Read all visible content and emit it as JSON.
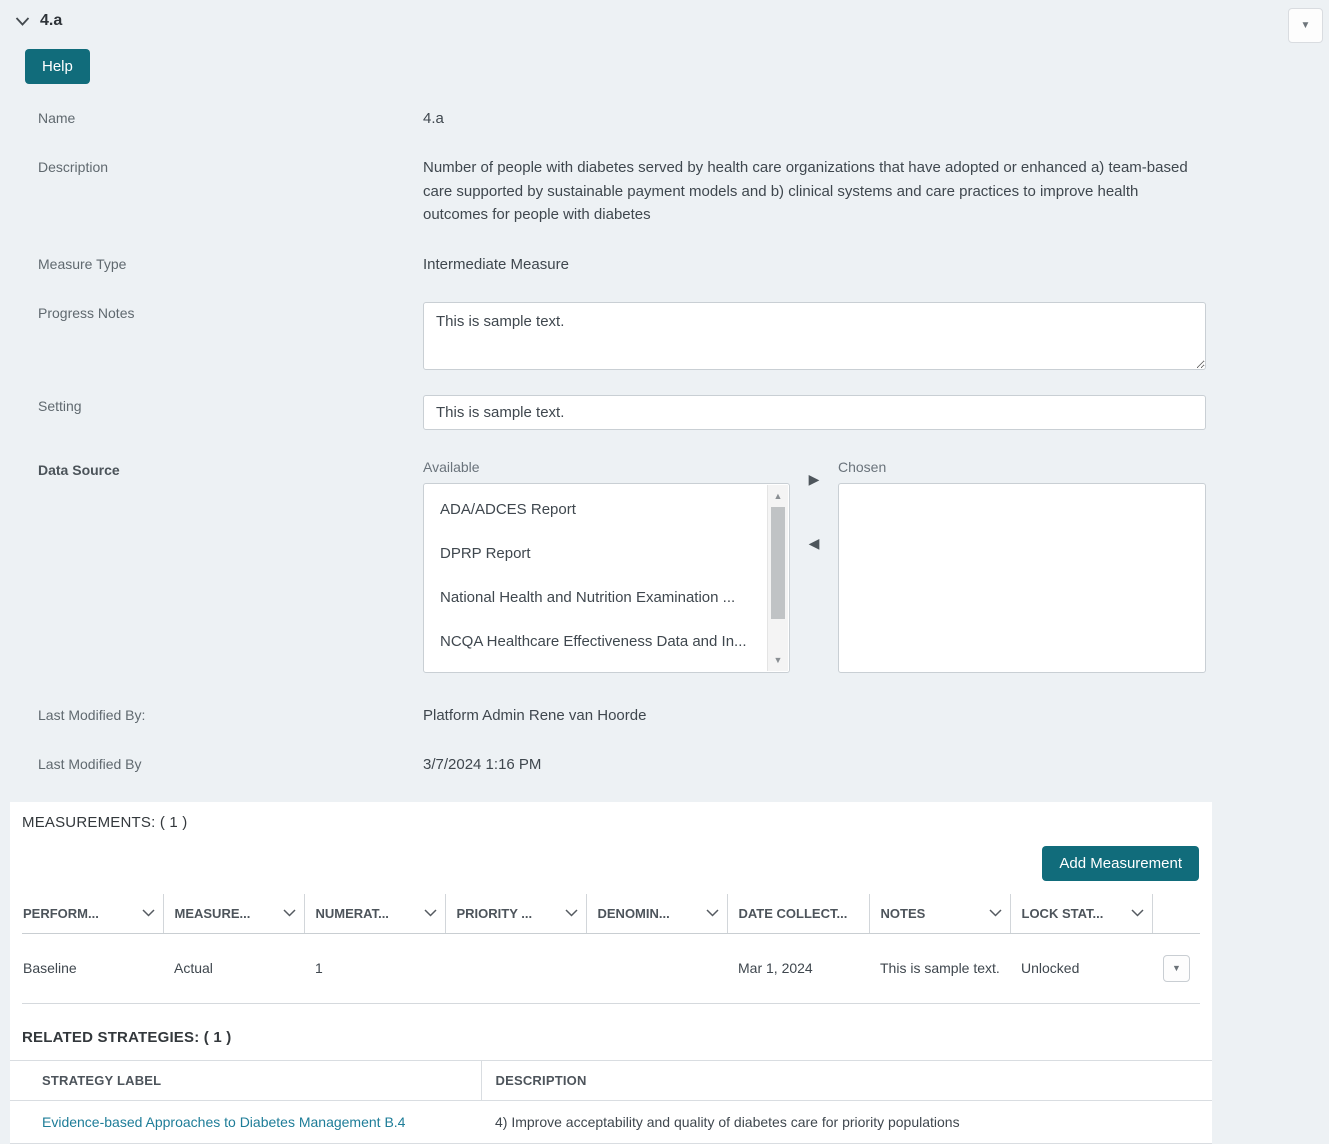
{
  "header": {
    "title": "4.a",
    "help_button": "Help"
  },
  "form": {
    "name": {
      "label": "Name",
      "value": "4.a"
    },
    "description": {
      "label": "Description",
      "value": "Number of people with diabetes served by health care organizations that have adopted or enhanced a) team-based care supported by sustainable payment models and b) clinical systems and care practices to improve health outcomes for people with diabetes"
    },
    "measure_type": {
      "label": "Measure Type",
      "value": "Intermediate Measure"
    },
    "progress_notes": {
      "label": "Progress Notes",
      "value": "This is sample text."
    },
    "setting": {
      "label": "Setting",
      "value": "This is sample text."
    },
    "data_source": {
      "label": "Data Source",
      "available_label": "Available",
      "chosen_label": "Chosen",
      "available_items": [
        "ADA/ADCES Report",
        "DPRP Report",
        "National Health and Nutrition Examination ...",
        "NCQA Healthcare Effectiveness Data and In..."
      ],
      "chosen_items": []
    },
    "last_modified_by": {
      "label": "Last Modified By:",
      "value": "Platform Admin Rene van Hoorde"
    },
    "last_modified_date": {
      "label": "Last Modified By",
      "value": "3/7/2024 1:16 PM"
    }
  },
  "measurements": {
    "title": "MEASUREMENTS: ( 1 )",
    "add_button": "Add Measurement",
    "columns": [
      {
        "label": "PERFORM...",
        "filter": true
      },
      {
        "label": "MEASURE...",
        "filter": true
      },
      {
        "label": "NUMERAT...",
        "filter": true
      },
      {
        "label": "PRIORITY ...",
        "filter": true
      },
      {
        "label": "DENOMIN...",
        "filter": true
      },
      {
        "label": "DATE COLLECT...",
        "filter": false
      },
      {
        "label": "NOTES",
        "filter": true
      },
      {
        "label": "LOCK STAT...",
        "filter": true
      }
    ],
    "rows": [
      {
        "performance": "Baseline",
        "measure": "Actual",
        "numerator": "1",
        "priority": "",
        "denominator": "",
        "date_collected": "Mar 1, 2024",
        "notes": "This is sample text.",
        "lock_status": "Unlocked"
      }
    ]
  },
  "related_strategies": {
    "title": "RELATED STRATEGIES: ( 1 )",
    "columns": {
      "strategy_label": "STRATEGY LABEL",
      "description": "DESCRIPTION"
    },
    "rows": [
      {
        "strategy_label": "Evidence-based Approaches to Diabetes Management B.4",
        "description": "4) Improve acceptability and quality of diabetes care for priority populations"
      }
    ]
  },
  "colors": {
    "accent_teal": "#116c7b",
    "link": "#1e7d98",
    "page_bg": "#edf1f4"
  }
}
